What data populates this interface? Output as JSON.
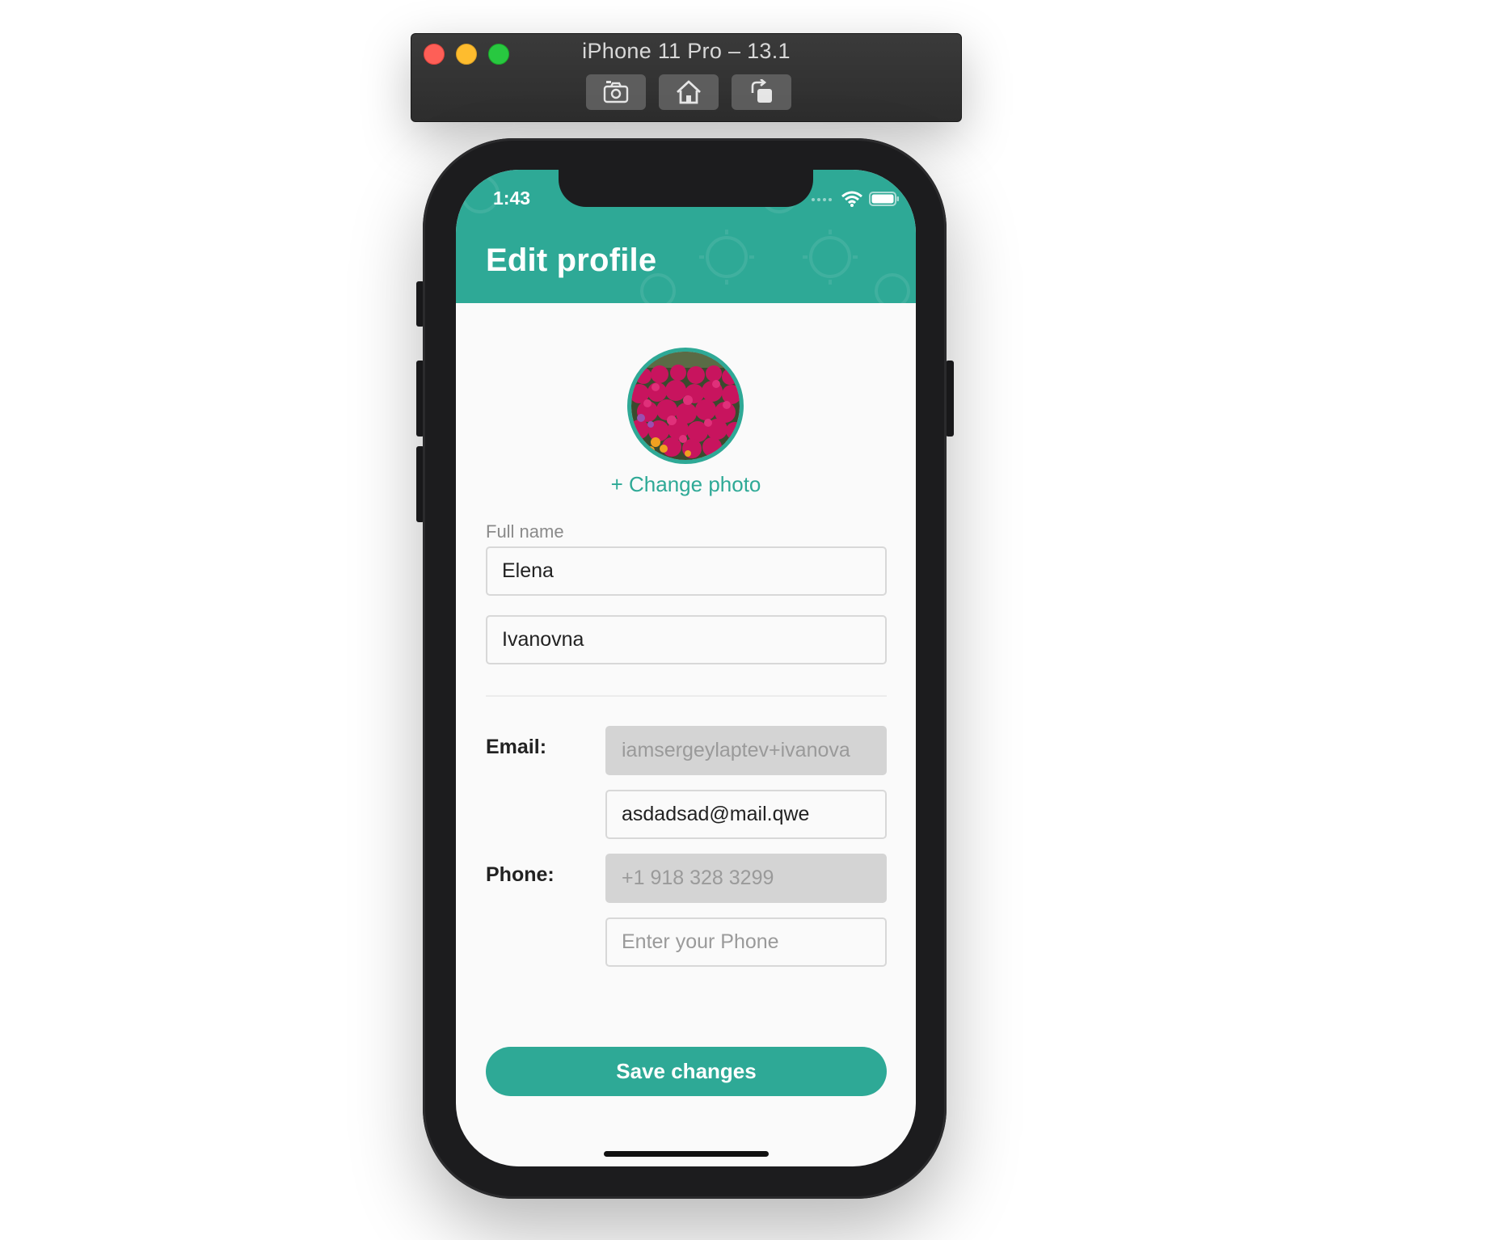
{
  "simulator": {
    "title": "iPhone 11 Pro – 13.1",
    "toolbar": {
      "screenshot_icon": "camera-icon",
      "home_icon": "home-icon",
      "rotate_icon": "rotate-icon"
    }
  },
  "status_bar": {
    "time": "1:43",
    "icons": [
      "signal-icon",
      "wifi-icon",
      "battery-icon"
    ]
  },
  "header": {
    "title": "Edit profile"
  },
  "profile": {
    "change_photo_label": "+ Change photo",
    "full_name_label": "Full name",
    "first_name_value": "Elena",
    "last_name_value": "Ivanovna"
  },
  "contact": {
    "email_label": "Email:",
    "email_current": "iamsergeylaptev+ivanova",
    "email_new_value": "asdadsad@mail.qwe",
    "phone_label": "Phone:",
    "phone_current": "+1 918 328 3299",
    "phone_new_placeholder": "Enter your Phone"
  },
  "actions": {
    "save_label": "Save changes"
  },
  "colors": {
    "accent": "#2ea996",
    "disabled_field": "#d4d4d4",
    "phone_frame": "#1c1c1e"
  }
}
